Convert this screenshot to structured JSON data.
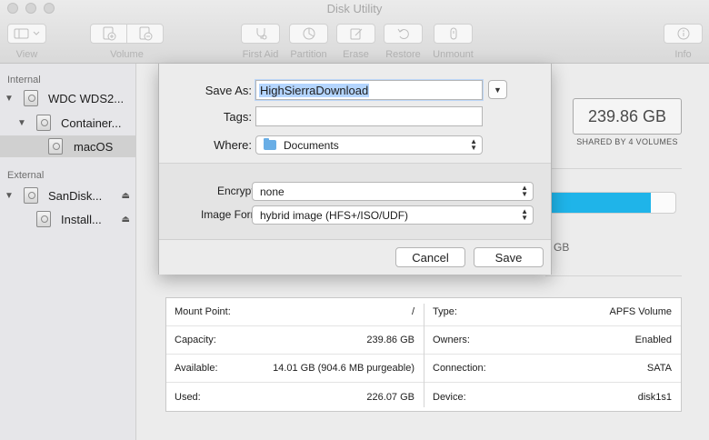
{
  "window": {
    "title": "Disk Utility"
  },
  "toolbar": {
    "view_label": "View",
    "volume_label": "Volume",
    "first_aid_label": "First Aid",
    "partition_label": "Partition",
    "erase_label": "Erase",
    "restore_label": "Restore",
    "unmount_label": "Unmount",
    "info_label": "Info"
  },
  "sidebar": {
    "internal_header": "Internal",
    "external_header": "External",
    "internal_items": [
      {
        "label": "WDC WDS2...",
        "icon": "hard-drive-icon"
      },
      {
        "label": "Container...",
        "icon": "container-icon"
      },
      {
        "label": "macOS",
        "icon": "volume-icon",
        "selected": true
      }
    ],
    "external_items": [
      {
        "label": "SanDisk...",
        "icon": "usb-drive-icon"
      },
      {
        "label": "Install...",
        "icon": "volume-icon"
      }
    ]
  },
  "summary": {
    "capacity": "239.86 GB",
    "shared_label": "SHARED BY 4 VOLUMES",
    "usage_fraction": 0.81,
    "usage_tail": "GB",
    "colors": {
      "usage_fill": "#1fb4e9"
    }
  },
  "info": {
    "left": [
      {
        "key": "Mount Point:",
        "value": "/"
      },
      {
        "key": "Capacity:",
        "value": "239.86 GB"
      },
      {
        "key": "Available:",
        "value": "14.01 GB (904.6 MB purgeable)"
      },
      {
        "key": "Used:",
        "value": "226.07 GB"
      }
    ],
    "right": [
      {
        "key": "Type:",
        "value": "APFS Volume"
      },
      {
        "key": "Owners:",
        "value": "Enabled"
      },
      {
        "key": "Connection:",
        "value": "SATA"
      },
      {
        "key": "Device:",
        "value": "disk1s1"
      }
    ]
  },
  "save_dialog": {
    "save_as_label": "Save As:",
    "save_as_value": "HighSierraDownload",
    "tags_label": "Tags:",
    "tags_value": "",
    "where_label": "Where:",
    "where_value": "Documents",
    "encryption_label": "Encryption:",
    "encryption_value": "none",
    "image_format_label": "Image Format:",
    "image_format_value": "hybrid image (HFS+/ISO/UDF)",
    "cancel_label": "Cancel",
    "save_label": "Save"
  }
}
